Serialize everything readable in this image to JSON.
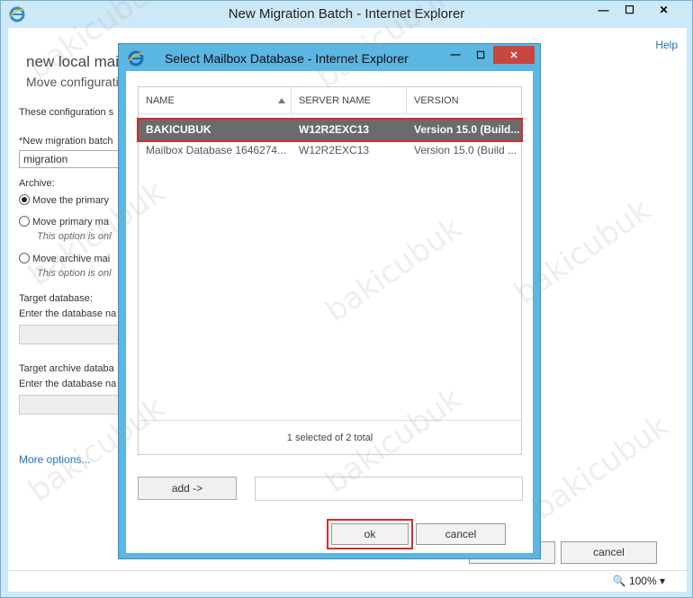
{
  "outer_window": {
    "title": "New Migration Batch - Internet Explorer",
    "help": "Help",
    "page_title": "new local mai",
    "page_subtitle": "Move configurati",
    "intro_text": "These configuration s",
    "batch_name_label": "*New migration batch",
    "batch_name_value": "migration",
    "archive_label": "Archive:",
    "option1": "Move the primary",
    "option2": "Move primary ma",
    "option2_note": "This option is onl",
    "option3": "Move archive mai",
    "option3_note": "This option is onl",
    "target_db_label": "Target database:",
    "target_db_hint": "Enter the database na",
    "target_archive_label": "Target archive databa",
    "target_archive_hint": "Enter the database na",
    "more_options": "More options...",
    "cancel": "cancel",
    "zoom": "100%"
  },
  "dialog": {
    "title": "Select Mailbox Database - Internet Explorer",
    "columns": [
      "NAME",
      "SERVER NAME",
      "VERSION"
    ],
    "rows": [
      {
        "name": "BAKICUBUK",
        "server": "W12R2EXC13",
        "version": "Version 15.0 (Build..."
      },
      {
        "name": "Mailbox Database 1646274...",
        "server": "W12R2EXC13",
        "version": "Version 15.0 (Build ..."
      }
    ],
    "status": "1 selected of 2 total",
    "add_button": "add ->",
    "ok_button": "ok",
    "cancel_button": "cancel"
  },
  "watermark": "bakicubuk"
}
